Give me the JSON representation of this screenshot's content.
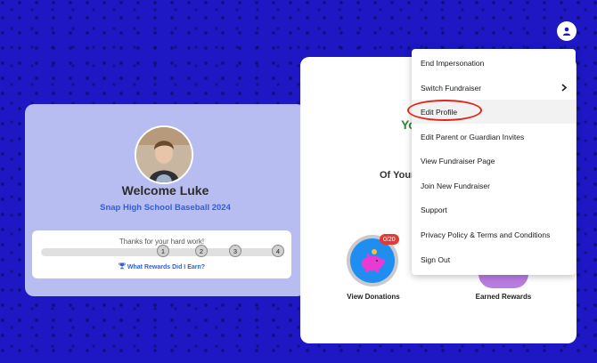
{
  "header": {
    "user_icon": "user-icon"
  },
  "welcome_card": {
    "title": "Welcome Luke",
    "fundraiser": "Snap High School Baseball 2024",
    "progress": {
      "message": "Thanks for your hard work!",
      "steps": [
        "1",
        "2",
        "3",
        "4"
      ],
      "rewards_link": "What Rewards Did I Earn?",
      "rewards_icon": "trophy-icon"
    }
  },
  "main_card": {
    "partial_heading": "Yo",
    "partial_subheading": "Of Your",
    "donations": {
      "label": "View Donations",
      "badge": "0/20",
      "icon": "piggy-bank-icon"
    },
    "rewards": {
      "label": "Earned Rewards"
    }
  },
  "menu": {
    "items": [
      {
        "label": "End Impersonation"
      },
      {
        "label": "Switch Fundraiser",
        "icon": "chevron-right-icon"
      },
      {
        "label": "Edit Profile"
      },
      {
        "label": "Edit Parent or Guardian Invites"
      },
      {
        "label": "View Fundraiser Page"
      },
      {
        "label": "Join New Fundraiser"
      },
      {
        "label": "Support"
      },
      {
        "label": "Privacy Policy & Terms and Conditions"
      },
      {
        "label": "Sign Out"
      }
    ]
  },
  "colors": {
    "background": "#1d17c4",
    "accent_blue": "#2d5fe0",
    "highlight": "#e0251b",
    "badge": "#e53935"
  }
}
